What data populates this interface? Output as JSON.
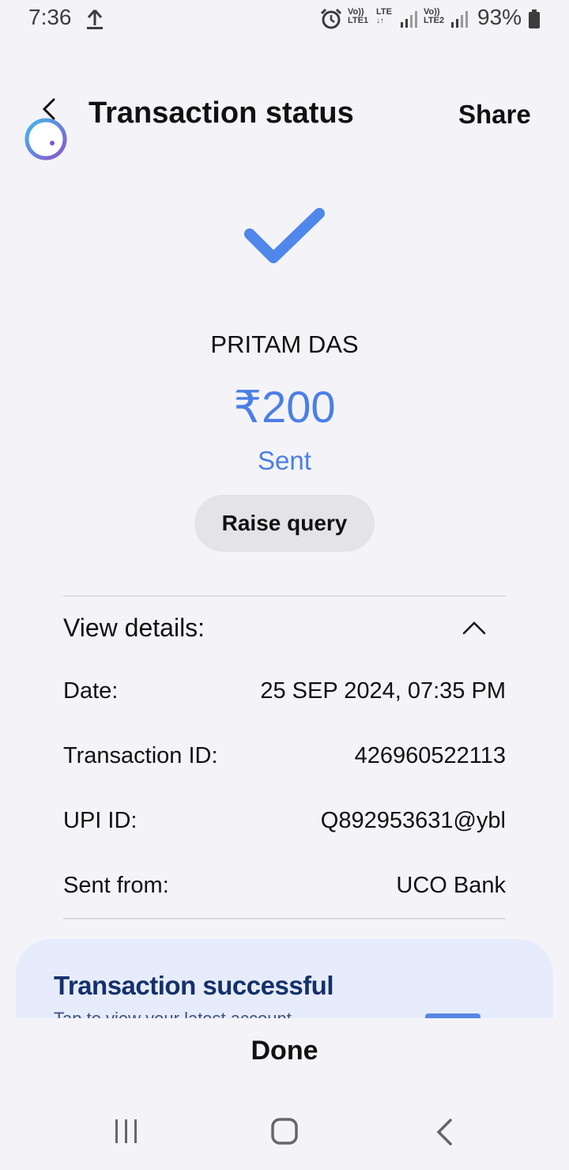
{
  "status_bar": {
    "time": "7:36",
    "sim1_top": "Vo))",
    "sim1_bottom": "LTE1",
    "lte_label": "LTE",
    "sim2_top": "Vo))",
    "sim2_bottom": "LTE2",
    "battery": "93%"
  },
  "header": {
    "title": "Transaction status",
    "share_label": "Share"
  },
  "transaction": {
    "payee": "PRITAM DAS",
    "amount": "₹200",
    "status": "Sent",
    "raise_query_label": "Raise query"
  },
  "details": {
    "header": "View details:",
    "rows": [
      {
        "label": "Date:",
        "value": "25 SEP 2024, 07:35 PM"
      },
      {
        "label": "Transaction ID:",
        "value": "426960522113"
      },
      {
        "label": "UPI ID:",
        "value": "Q892953631@ybl"
      },
      {
        "label": "Sent from:",
        "value": "UCO Bank"
      }
    ]
  },
  "banner": {
    "title": "Transaction successful",
    "subtext": "Tap to view your latest account"
  },
  "footer": {
    "done_label": "Done"
  },
  "colors": {
    "accent": "#4a7fe6",
    "banner_bg": "#e6ecfb",
    "banner_title": "#15306b"
  }
}
